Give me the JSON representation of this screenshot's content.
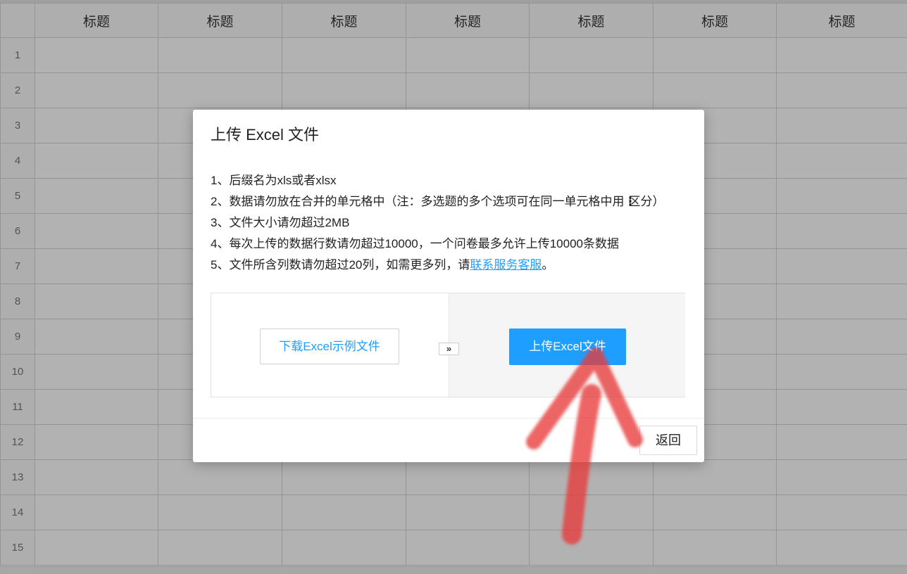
{
  "spreadsheet": {
    "headers": [
      "",
      "标题",
      "标题",
      "标题",
      "标题",
      "标题",
      "标题",
      "标题"
    ],
    "rows": [
      "1",
      "2",
      "3",
      "4",
      "5",
      "6",
      "7",
      "8",
      "9",
      "10",
      "11",
      "12",
      "13",
      "14",
      "15"
    ]
  },
  "dialog": {
    "title": "上传 Excel 文件",
    "rules": [
      "1、后缀名为xls或者xlsx",
      "2、数据请勿放在合并的单元格中（注：多选题的多个选项可在同一单元格中用",
      "3、文件大小请勿超过2MB",
      "4、每次上传的数据行数请勿超过10000，一个问卷最多允许上传10000条数据",
      "5、文件所含列数请勿超过20列，如需更多列，请"
    ],
    "rule2_sep": "⋮",
    "rule2_suffix": "区分）",
    "rule5_link": "联系服务客服",
    "rule5_suffix": "。",
    "download_button": "下载Excel示例文件",
    "arrow_chip": "»",
    "upload_button": "上传Excel文件",
    "back_button": "返回"
  },
  "colors": {
    "accent": "#1e9fff",
    "annotation_arrow": "#e83a3a"
  }
}
